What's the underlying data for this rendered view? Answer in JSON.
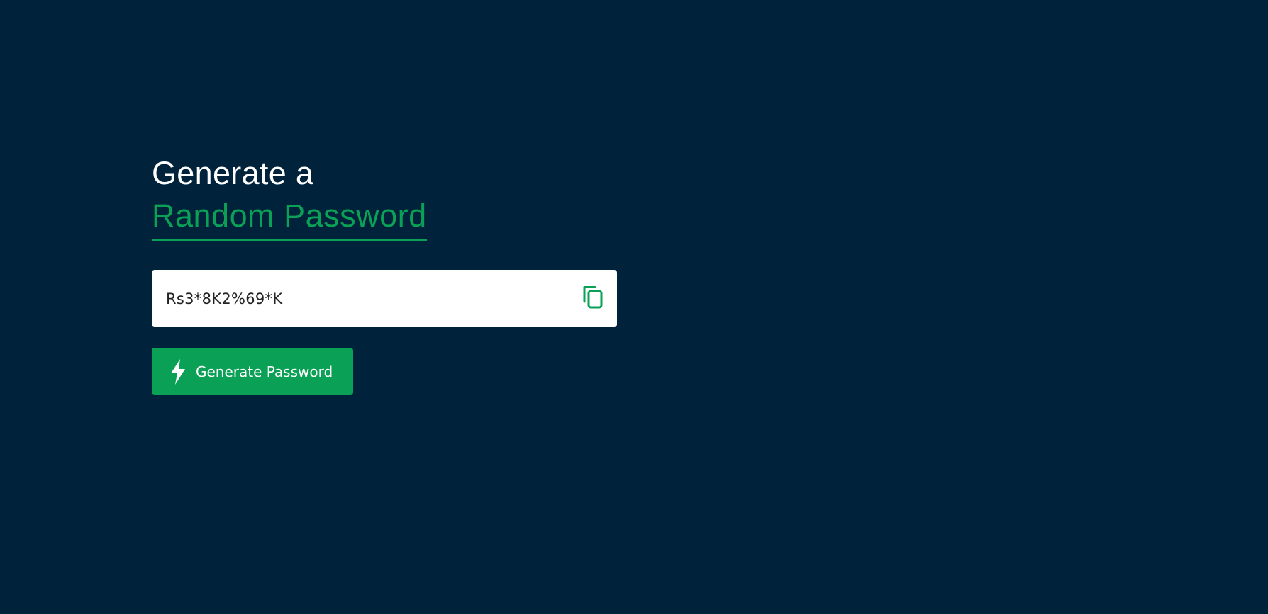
{
  "heading": {
    "line1": "Generate a",
    "line2": "Random Password"
  },
  "password_field": {
    "value": "Rs3*8K2%69*K",
    "copy_icon": "copy-icon"
  },
  "generate_button": {
    "label": "Generate Password",
    "icon": "lightning-bolt-icon"
  },
  "colors": {
    "background": "#00223a",
    "accent": "#0aa055",
    "field_background": "#ffffff"
  }
}
